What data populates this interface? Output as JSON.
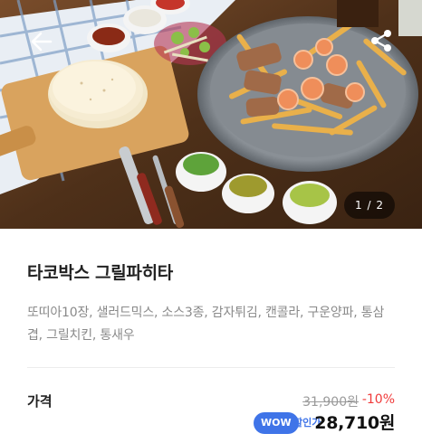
{
  "hero": {
    "pager_current": "1",
    "pager_total": "2",
    "pager_text": "1 / 2"
  },
  "product": {
    "title": "타코박스 그릴파히타",
    "description": "또띠아10장, 샐러드믹스, 소스3종, 감자튀김, 캔콜라, 구운양파, 통삼겹, 그릴치킨, 통새우"
  },
  "price": {
    "label": "가격",
    "original": "31,900원",
    "discount": "-10%",
    "wow_badge": "WOW",
    "member_label": "할인가",
    "final": "28,710원"
  },
  "icons": {
    "back": "arrow-left-icon",
    "share": "share-icon"
  },
  "colors": {
    "discount": "#f03a3a",
    "wow": "#3f74e8",
    "desc_text": "#8a8a8a"
  }
}
